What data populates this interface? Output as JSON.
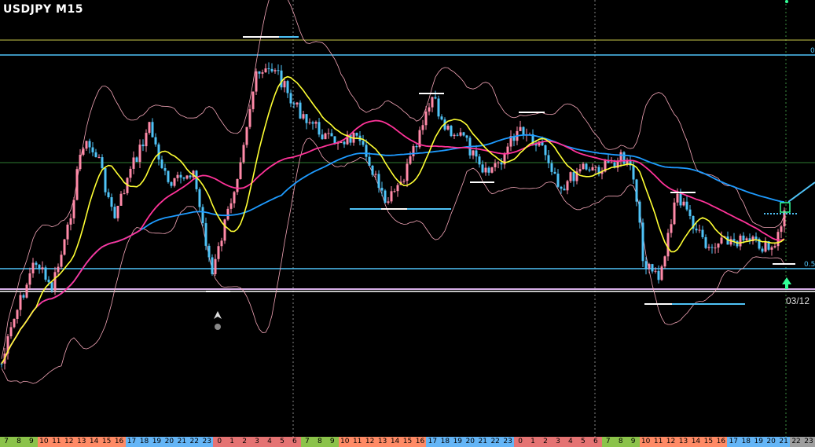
{
  "chart_data": {
    "type": "candlestick",
    "title": "USDJPY M15",
    "date_marker": "03/12",
    "fib_labels": [
      "0",
      "0.5"
    ],
    "x_ticks": [
      "7",
      "8",
      "9",
      "10",
      "11",
      "12",
      "13",
      "14",
      "15",
      "16",
      "17",
      "18",
      "19",
      "20",
      "21",
      "22",
      "23",
      "0",
      "1",
      "2",
      "3",
      "4",
      "5",
      "6",
      "7",
      "8",
      "9",
      "10",
      "11",
      "12",
      "13",
      "14",
      "15",
      "16",
      "17",
      "18",
      "19",
      "20",
      "21",
      "22",
      "23",
      "0",
      "1",
      "2",
      "3",
      "4",
      "5",
      "6",
      "7",
      "8",
      "9",
      "10",
      "11",
      "12",
      "13",
      "14",
      "15",
      "16",
      "17",
      "18",
      "19",
      "20",
      "21",
      "22",
      "23"
    ],
    "x_tick_colors": [
      "#8bc34a",
      "#8bc34a",
      "#8bc34a",
      "#ff8a65",
      "#ff8a65",
      "#ff8a65",
      "#ff8a65",
      "#ff8a65",
      "#ff8a65",
      "#ff8a65",
      "#64b5f6",
      "#64b5f6",
      "#64b5f6",
      "#64b5f6",
      "#64b5f6",
      "#64b5f6",
      "#64b5f6",
      "#e57373",
      "#e57373",
      "#e57373",
      "#e57373",
      "#e57373",
      "#e57373",
      "#e57373",
      "#8bc34a",
      "#8bc34a",
      "#8bc34a",
      "#ff8a65",
      "#ff8a65",
      "#ff8a65",
      "#ff8a65",
      "#ff8a65",
      "#ff8a65",
      "#ff8a65",
      "#64b5f6",
      "#64b5f6",
      "#64b5f6",
      "#64b5f6",
      "#64b5f6",
      "#64b5f6",
      "#64b5f6",
      "#e57373",
      "#e57373",
      "#e57373",
      "#e57373",
      "#e57373",
      "#e57373",
      "#e57373",
      "#8bc34a",
      "#8bc34a",
      "#8bc34a",
      "#ff8a65",
      "#ff8a65",
      "#ff8a65",
      "#ff8a65",
      "#ff8a65",
      "#ff8a65",
      "#ff8a65",
      "#64b5f6",
      "#64b5f6",
      "#64b5f6",
      "#64b5f6",
      "#64b5f6",
      "#9e9e9e",
      "#9e9e9e"
    ],
    "series": [
      {
        "kind": "ma-fast",
        "color": "#ffff33"
      },
      {
        "kind": "ma-mid",
        "color": "#ff3399"
      },
      {
        "kind": "ma-slow",
        "color": "#1e9bff"
      },
      {
        "kind": "bollinger",
        "color": "#f4a6b8"
      }
    ],
    "price_path": [
      [
        0,
        470
      ],
      [
        20,
        400
      ],
      [
        45,
        330
      ],
      [
        65,
        370
      ],
      [
        85,
        300
      ],
      [
        105,
        180
      ],
      [
        125,
        200
      ],
      [
        145,
        280
      ],
      [
        165,
        220
      ],
      [
        190,
        160
      ],
      [
        215,
        240
      ],
      [
        245,
        215
      ],
      [
        270,
        350
      ],
      [
        300,
        230
      ],
      [
        325,
        100
      ],
      [
        350,
        85
      ],
      [
        370,
        130
      ],
      [
        395,
        155
      ],
      [
        420,
        180
      ],
      [
        450,
        175
      ],
      [
        470,
        205
      ],
      [
        490,
        262
      ],
      [
        510,
        235
      ],
      [
        530,
        185
      ],
      [
        550,
        125
      ],
      [
        565,
        160
      ],
      [
        590,
        175
      ],
      [
        615,
        225
      ],
      [
        640,
        200
      ],
      [
        660,
        160
      ],
      [
        690,
        185
      ],
      [
        715,
        240
      ],
      [
        740,
        210
      ],
      [
        765,
        215
      ],
      [
        790,
        200
      ],
      [
        805,
        220
      ],
      [
        820,
        340
      ],
      [
        840,
        355
      ],
      [
        860,
        245
      ],
      [
        880,
        280
      ],
      [
        900,
        320
      ],
      [
        930,
        305
      ],
      [
        960,
        310
      ],
      [
        985,
        320
      ],
      [
        1000,
        260
      ]
    ],
    "candle_colors": {
      "up": "#ff8aa8",
      "down": "#4fc3f7"
    },
    "lines": {
      "cyan": "#4fc3f7",
      "yellow_green": "#c8c84a",
      "green": "#2e7d32",
      "white": "#ffffff",
      "lavender": "#d7aee8"
    }
  }
}
